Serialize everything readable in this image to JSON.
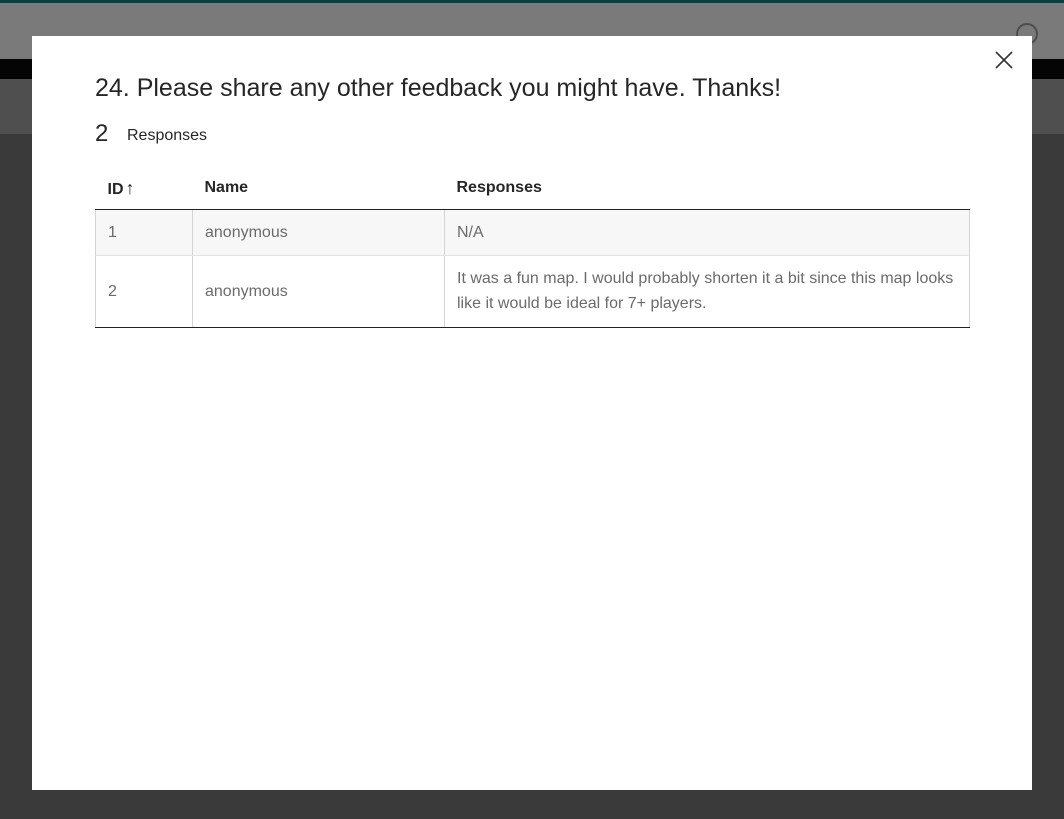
{
  "question": {
    "title": "24. Please share any other feedback you might have. Thanks!",
    "response_count": "2",
    "response_label": "Responses"
  },
  "table": {
    "headers": {
      "id": "ID",
      "id_sort_arrow": "↑",
      "name": "Name",
      "responses": "Responses"
    },
    "rows": [
      {
        "id": "1",
        "name": "anonymous",
        "response": "N/A"
      },
      {
        "id": "2",
        "name": "anonymous",
        "response": "It was a fun map. I would probably shorten it a bit since this map looks like it would be ideal for 7+ players."
      }
    ]
  },
  "icons": {
    "close": "close-icon"
  }
}
